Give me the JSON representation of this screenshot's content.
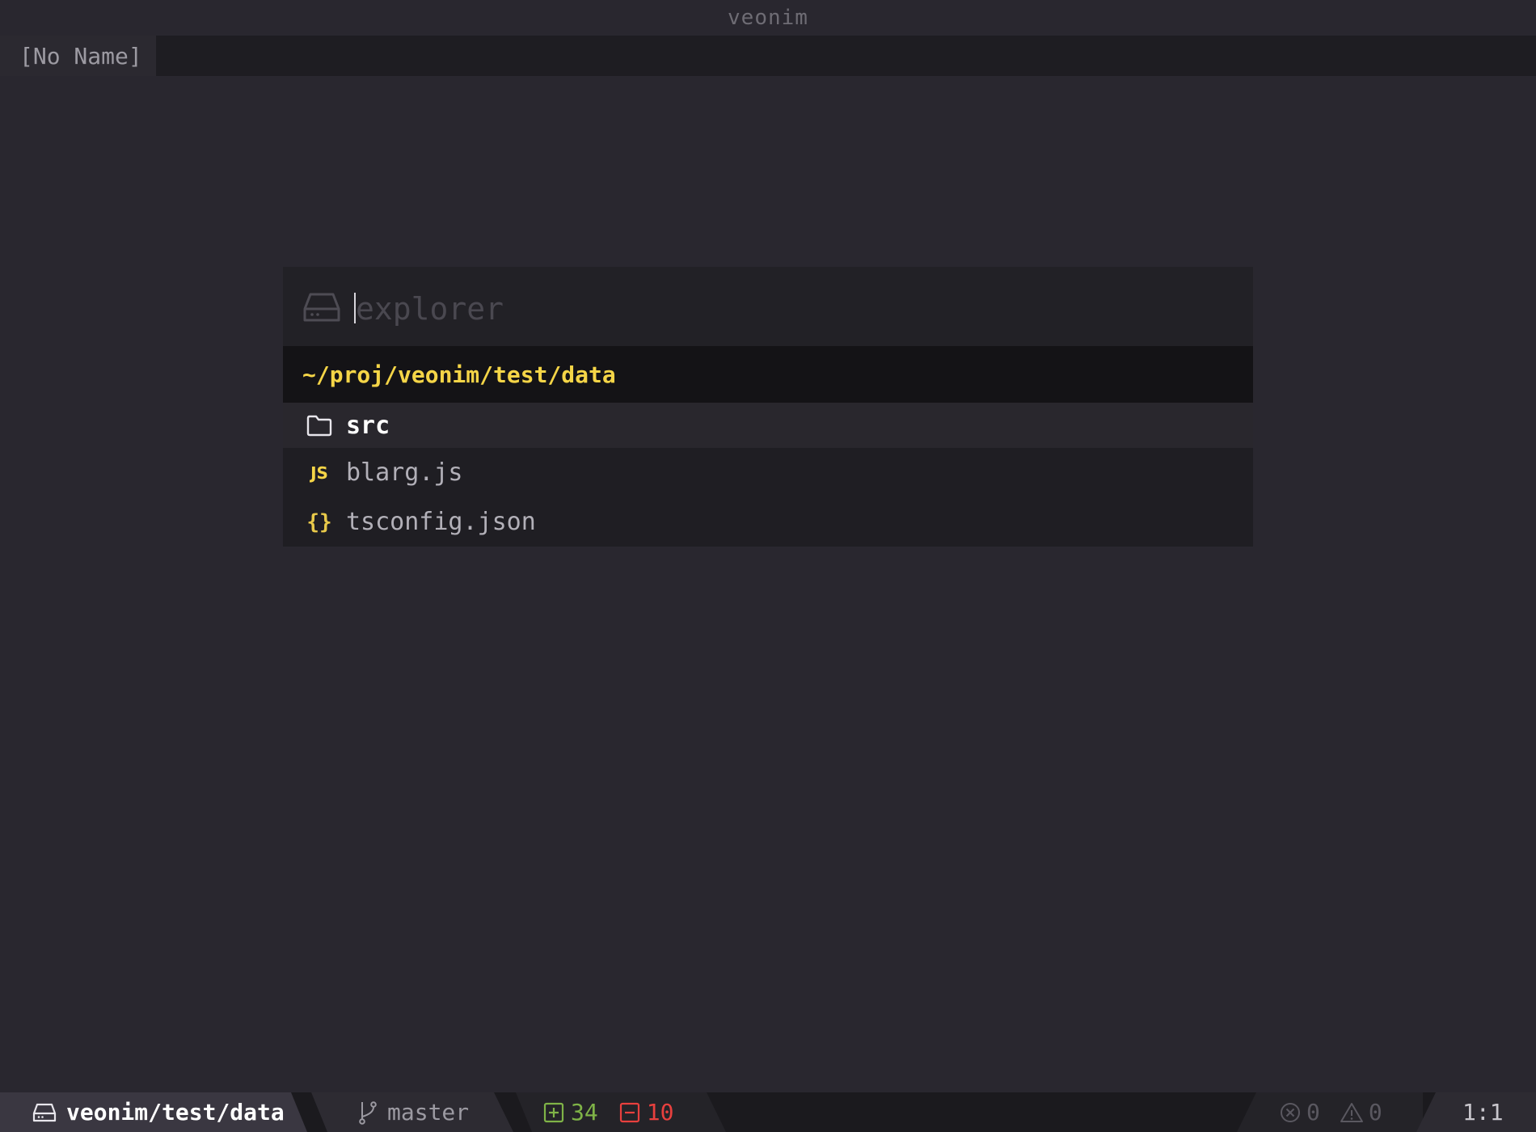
{
  "window": {
    "title": "veonim"
  },
  "tabline": {
    "tabs": [
      {
        "label": "[No Name]"
      }
    ]
  },
  "explorer": {
    "placeholder": "explorer",
    "input_value": "",
    "path": "~/proj/veonim/test/data",
    "items": [
      {
        "label": "src",
        "icon": "folder-icon",
        "selected": true
      },
      {
        "label": "blarg.js",
        "icon": "javascript-file-icon",
        "icon_text": "JS",
        "selected": false
      },
      {
        "label": "tsconfig.json",
        "icon": "json-file-icon",
        "icon_text": "{}",
        "selected": false
      }
    ]
  },
  "statusline": {
    "project": "veonim/test/data",
    "branch": "master",
    "additions": "34",
    "deletions": "10",
    "errors": "0",
    "warnings": "0",
    "position": "1:1"
  },
  "colors": {
    "background": "#29272f",
    "path_accent": "#f5d547",
    "additions": "#7fb347",
    "deletions": "#e8403e"
  }
}
